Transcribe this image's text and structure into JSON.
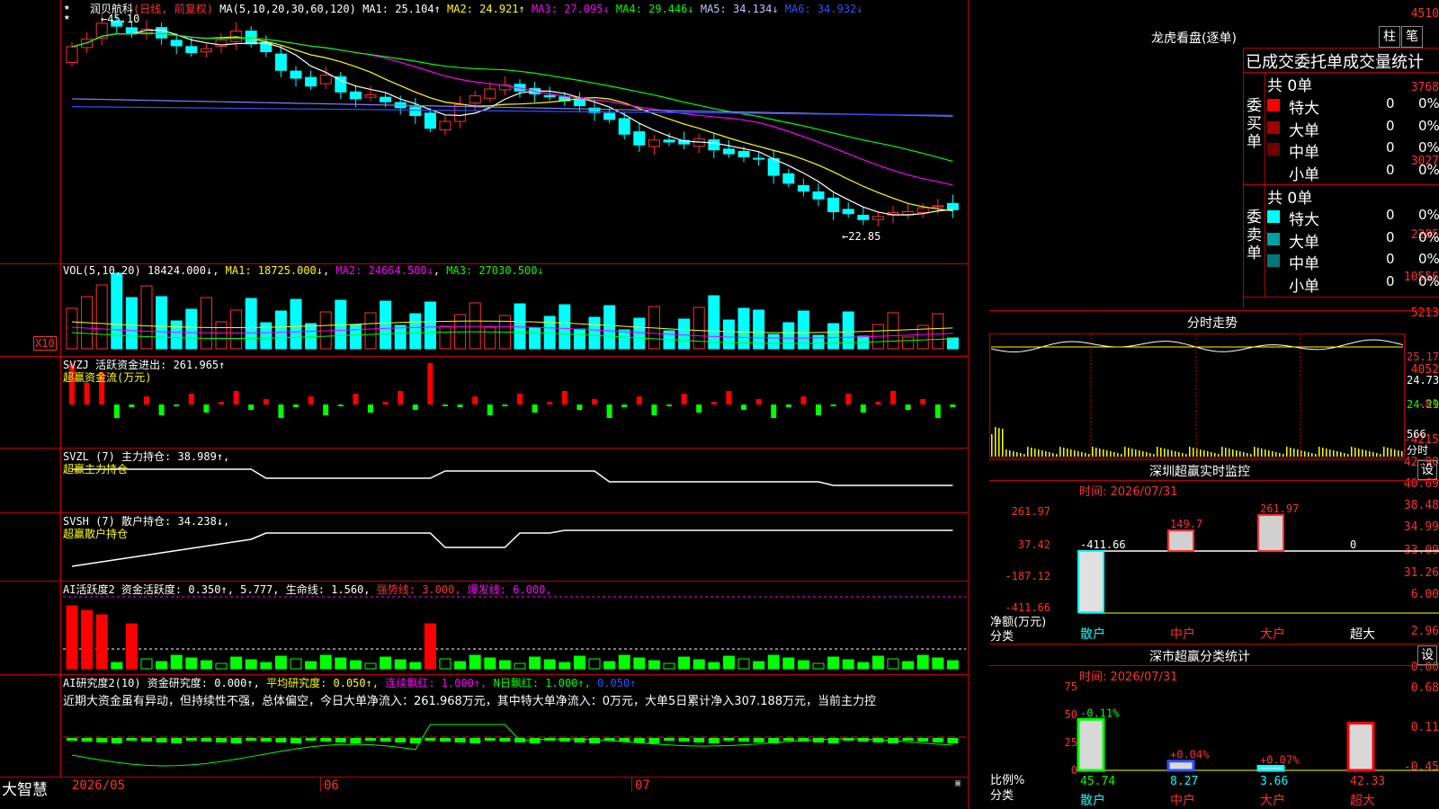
{
  "main": {
    "price_labels": [
      "4510",
      "3768",
      "3027",
      "2285"
    ],
    "header": {
      "stock": "润贝航科",
      "period": "(日线, 前复权)",
      "ma_title": "MA(5,10,20,30,60,120)",
      "ma1": "MA1: 25.104↑",
      "ma2": "MA2: 24.921↑",
      "ma3": "MA3: 27.095↓",
      "ma4": "MA4: 29.446↓",
      "ma5": "MA5: 34.134↓",
      "ma6": "MA6: 34.932↓"
    },
    "high_marker": "45.10",
    "low_marker": "22.85",
    "star_markers": [
      "★",
      "★"
    ],
    "colors": {
      "ma1": "#ffffff",
      "ma2": "#ffff00",
      "ma3": "#ff00ff",
      "ma4": "#00ff00",
      "ma5": "#8080ff",
      "ma6": "#3050ff"
    }
  },
  "vol": {
    "labels": [
      "10556",
      "5213"
    ],
    "scale": "X10",
    "header": {
      "title": "VOL(5,10,20)",
      "value": "18424.000↓",
      "ma1": "MA1: 18725.000↓",
      "ma2": "MA2: 24664.500↓",
      "ma3": "MA3: 27030.500↓"
    }
  },
  "svzj": {
    "labels": [
      "4052",
      "-81",
      "-4215"
    ],
    "header": {
      "title": "SVZJ  活跃资金进出: 261.965↑",
      "sub": "超赢资金流(万元)"
    }
  },
  "svzl": {
    "labels": [
      "42.90",
      "40.69",
      "38.48"
    ],
    "header": {
      "title": "SVZL (7) 主力持仓: 38.989↑,",
      "sub": "超赢主力持仓"
    }
  },
  "svsh": {
    "labels": [
      "34.99",
      "33.09",
      "31.26"
    ],
    "header": {
      "title": "SVSH (7) 散户持仓: 34.238↓,",
      "sub": "超赢散户持仓"
    }
  },
  "ai1": {
    "labels": [
      "6.00",
      "2.96",
      "0.00"
    ],
    "header": {
      "title": "AI活跃度2 资金活跃度: 0.350↑, 5.777, 生命线: 1.560,",
      "strong": "强势线: 3.000,",
      "burst": "爆发线: 6.000,"
    }
  },
  "ai2": {
    "labels": [
      "0.68",
      "0.11",
      "-0.45"
    ],
    "header": {
      "title": "AI研究度2(10) 资金研究度: 0.000↑,",
      "avg": "平均研究度: 0.050↑,",
      "streak": "连续飘红: 1.000↑,",
      "nday": "N日飘红: 1.000↑,",
      "last": "0.050↑"
    },
    "comment": "近期大资金虽有异动，但持续性不强，总体偏空，今日大单净流入：261.968万元，其中特大单净流入：0万元，大单5日累计净入307.188万元，当前主力控"
  },
  "xaxis": {
    "brand": "大智慧",
    "labels": [
      "2026/05",
      "06",
      "07"
    ]
  },
  "right": {
    "lhb": {
      "title": "龙虎看盘(逐单)",
      "btn_zhu": "柱",
      "btn_bi": "笔",
      "subtitle": "已成交委托单成交量统计",
      "buy_label": "委买单",
      "sell_label": "委卖单",
      "buy_total": "共 0单",
      "sell_total": "共 0单",
      "buy_rows": [
        {
          "name": "特大",
          "count": "0",
          "pct": "0%",
          "color": "#ff0000"
        },
        {
          "name": "大单",
          "count": "0",
          "pct": "0%",
          "color": "#a00000"
        },
        {
          "name": "中单",
          "count": "0",
          "pct": "0%",
          "color": "#700000"
        },
        {
          "name": "小单",
          "count": "0",
          "pct": "0%",
          "color": ""
        }
      ],
      "sell_rows": [
        {
          "name": "特大",
          "count": "0",
          "pct": "0%",
          "color": "#00ffff"
        },
        {
          "name": "大单",
          "count": "0",
          "pct": "0%",
          "color": "#00a0a0"
        },
        {
          "name": "中单",
          "count": "0",
          "pct": "0%",
          "color": "#007878"
        },
        {
          "name": "小单",
          "count": "0",
          "pct": "0%",
          "color": ""
        }
      ]
    },
    "intraday": {
      "title": "分时走势",
      "labels": [
        "25.17",
        "24.73",
        "24.29"
      ],
      "vol_label": "566",
      "vol_unit": "分时"
    },
    "sz_monitor": {
      "title": "深圳超赢实时监控",
      "btn": "设",
      "time": "时间: 2026/07/31",
      "ylabels": [
        "261.97",
        "37.42",
        "-187.12",
        "-411.66"
      ],
      "ytitle": "净额(万元)",
      "xtitle": "分类",
      "categories": [
        "散户",
        "中户",
        "大户",
        "超大"
      ],
      "values": [
        -411.66,
        149.7,
        261.97,
        0
      ],
      "value_labels": [
        "-411.66",
        "149.7",
        "261.97",
        "0"
      ]
    },
    "sz_stats": {
      "title": "深市超赢分类统计",
      "btn": "设",
      "time": "时间: 2026/07/31",
      "ylabels": [
        "75",
        "50",
        "25",
        "0"
      ],
      "ytitle": "比例%",
      "xtitle": "分类",
      "categories": [
        "散户",
        "中户",
        "大户",
        "超大"
      ],
      "values": [
        45.74,
        8.27,
        3.66,
        42.33
      ],
      "changes": [
        "-0.11%",
        "+0.04%",
        "+0.07%",
        ""
      ]
    }
  }
}
